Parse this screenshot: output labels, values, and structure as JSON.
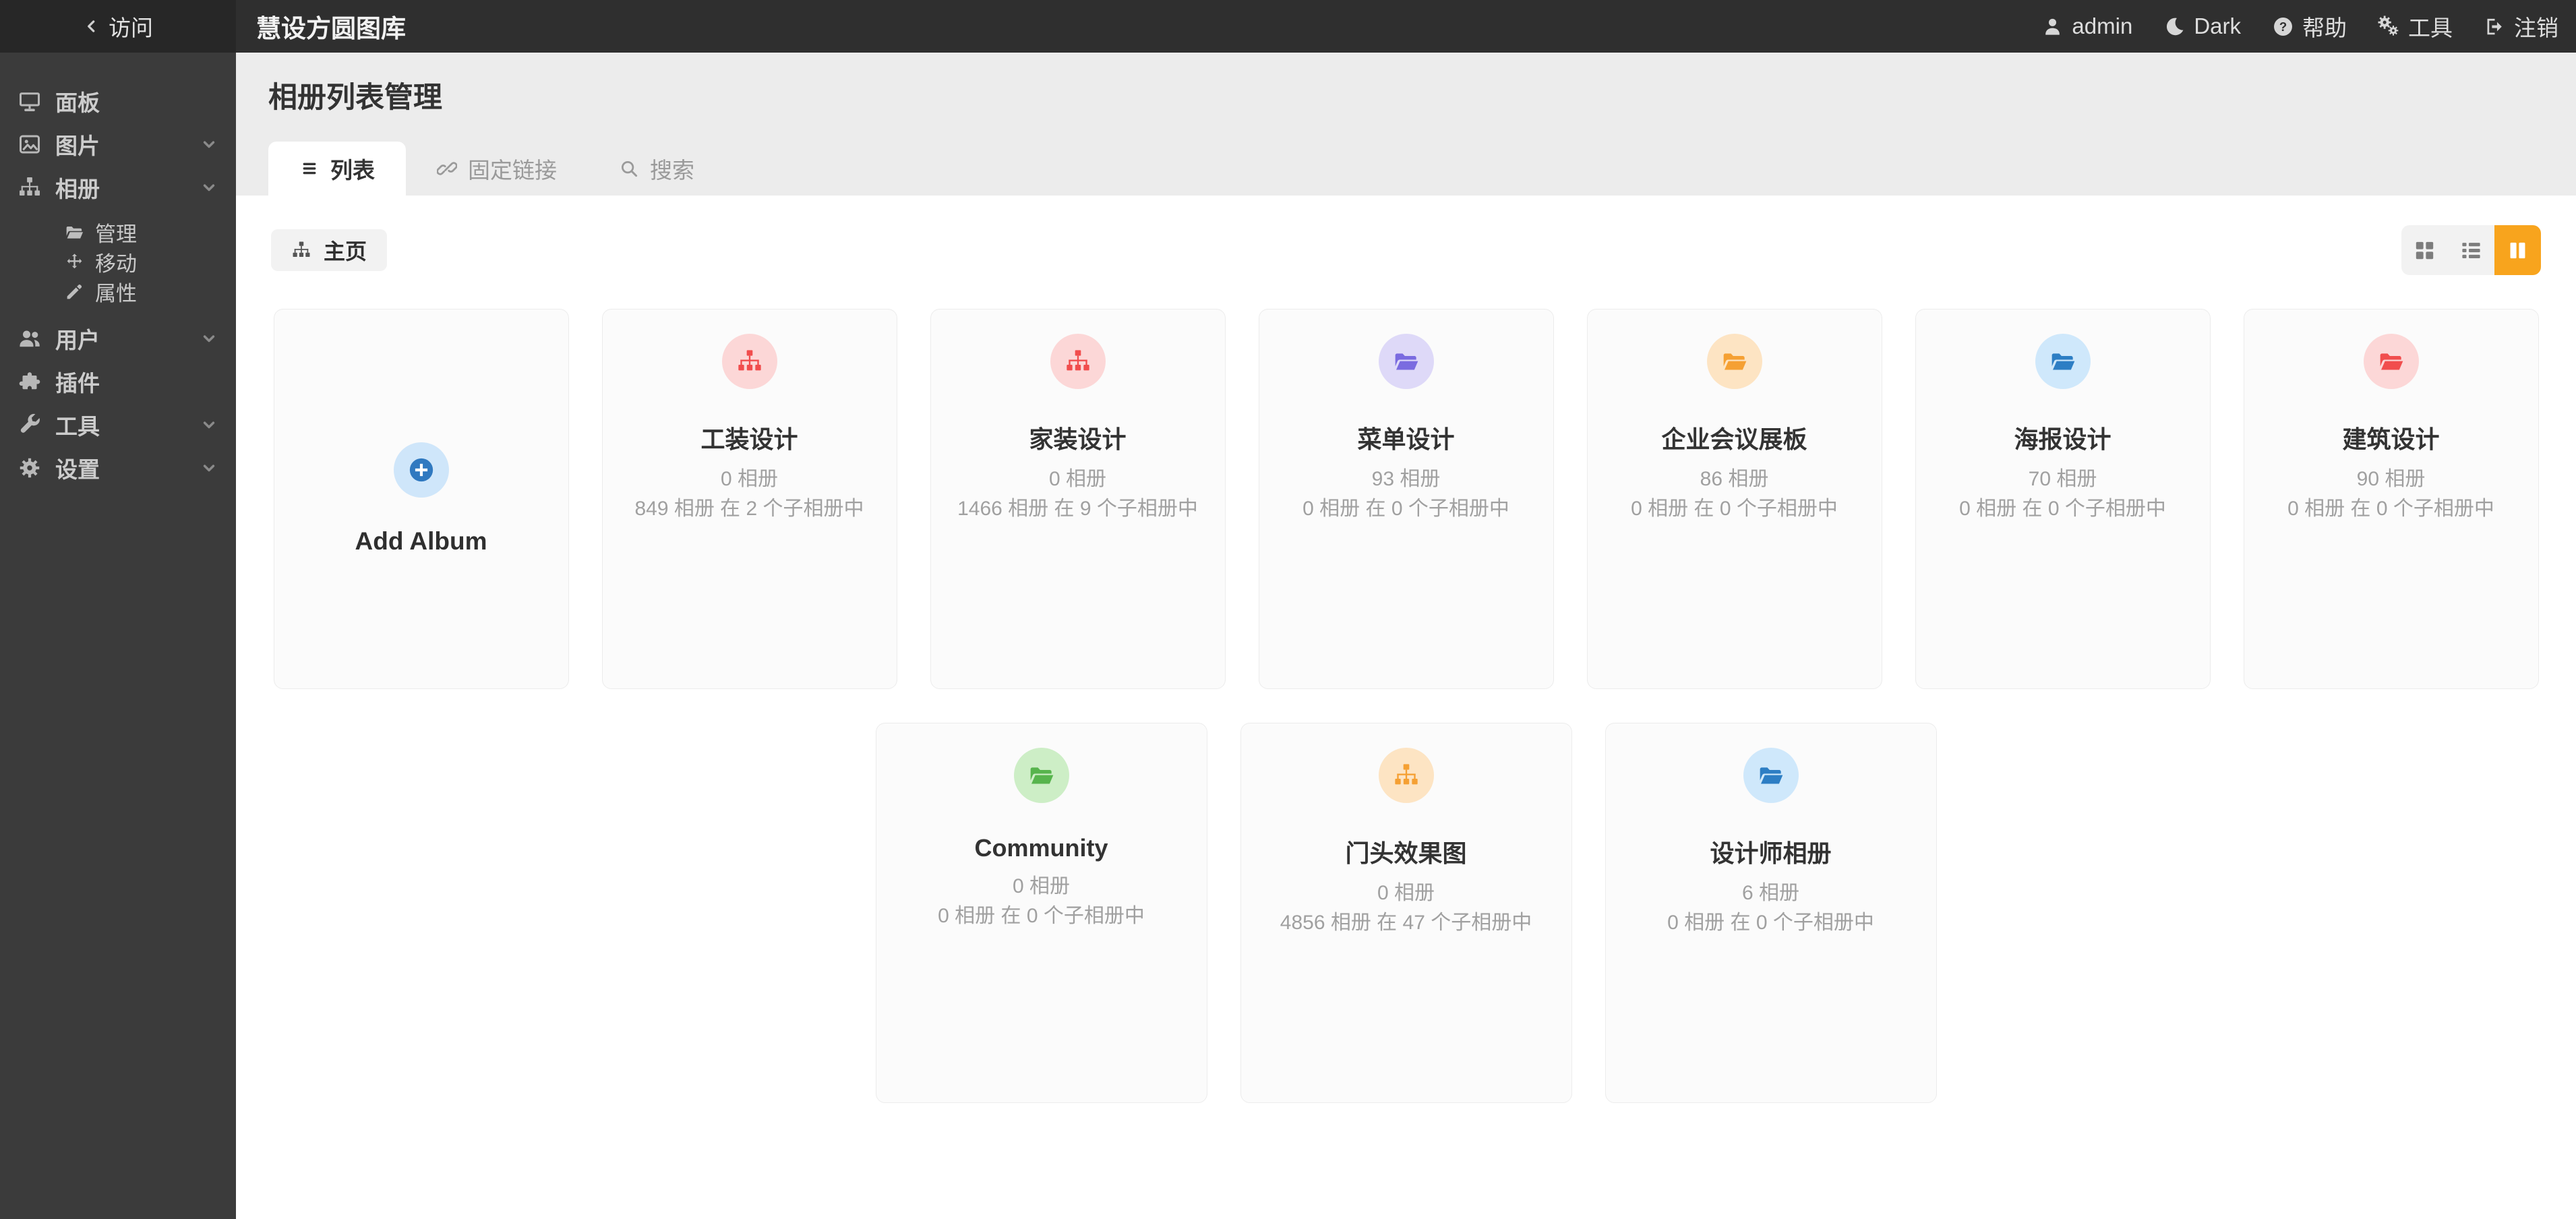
{
  "colors": {
    "accent_orange": "#f8a41d",
    "topbar_bg": "#2f2f2f",
    "sidebar_bg": "#3b3b3b",
    "header_bg": "#ececec"
  },
  "topbar": {
    "back_label": "访问",
    "app_title": "慧设方圆图库",
    "menu": [
      {
        "id": "user",
        "icon": "user-icon",
        "label": "admin"
      },
      {
        "id": "theme",
        "icon": "moon-icon",
        "label": "Dark"
      },
      {
        "id": "help",
        "icon": "help-icon",
        "label": "帮助"
      },
      {
        "id": "tools",
        "icon": "gears-icon",
        "label": "工具"
      },
      {
        "id": "logout",
        "icon": "sign-out-icon",
        "label": "注销"
      }
    ]
  },
  "sidebar": {
    "items": [
      {
        "id": "dashboard",
        "icon": "desktop-icon",
        "label": "面板",
        "chevron": false
      },
      {
        "id": "photos",
        "icon": "image-icon",
        "label": "图片",
        "chevron": true
      },
      {
        "id": "albums",
        "icon": "sitemap-icon",
        "label": "相册",
        "chevron": true,
        "children": [
          {
            "id": "manage",
            "icon": "folder-open-icon",
            "label": "管理"
          },
          {
            "id": "move",
            "icon": "move-icon",
            "label": "移动"
          },
          {
            "id": "properties",
            "icon": "pencil-icon",
            "label": "属性"
          }
        ]
      },
      {
        "id": "users",
        "icon": "users-icon",
        "label": "用户",
        "chevron": true
      },
      {
        "id": "plugins",
        "icon": "puzzle-icon",
        "label": "插件",
        "chevron": false
      },
      {
        "id": "tools",
        "icon": "wrench-icon",
        "label": "工具",
        "chevron": true
      },
      {
        "id": "settings",
        "icon": "gear-icon",
        "label": "设置",
        "chevron": true
      }
    ]
  },
  "page": {
    "title": "相册列表管理",
    "tabs": [
      {
        "id": "list",
        "icon": "list-icon",
        "label": "列表",
        "active": true
      },
      {
        "id": "permalinks",
        "icon": "link-icon",
        "label": "固定链接",
        "active": false
      },
      {
        "id": "search",
        "icon": "search-icon",
        "label": "搜索",
        "active": false
      }
    ],
    "breadcrumb": {
      "icon": "sitemap-icon",
      "label": "主页"
    },
    "view_toggle": [
      {
        "id": "grid",
        "icon": "grid-icon",
        "active": false
      },
      {
        "id": "list",
        "icon": "list-view-icon",
        "active": false
      },
      {
        "id": "columns",
        "icon": "columns-icon",
        "active": true
      }
    ]
  },
  "albums": {
    "add_card": {
      "label": "Add Album",
      "icon": "plus-circle-icon",
      "icon_color": "#3079c0",
      "circle_bg": "#cfe6fa"
    },
    "cards": [
      {
        "name": "工装设计",
        "icon": "sitemap-icon",
        "icon_color": "#f14d4d",
        "circle_bg": "#fcd7d7",
        "line1": "0 相册",
        "line2": "849 相册 在 2 个子相册中",
        "row": 1
      },
      {
        "name": "家装设计",
        "icon": "sitemap-icon",
        "icon_color": "#f14d4d",
        "circle_bg": "#fcd7d7",
        "line1": "0 相册",
        "line2": "1466 相册 在 9 个子相册中",
        "row": 1
      },
      {
        "name": "菜单设计",
        "icon": "folder-open-icon",
        "icon_color": "#7a6be0",
        "circle_bg": "#ded9f8",
        "line1": "93 相册",
        "line2": "0 相册 在 0 个子相册中",
        "row": 1
      },
      {
        "name": "企业会议展板",
        "icon": "folder-open-icon",
        "icon_color": "#f5a033",
        "circle_bg": "#fde4c3",
        "line1": "86 相册",
        "line2": "0 相册 在 0 个子相册中",
        "row": 1
      },
      {
        "name": "海报设计",
        "icon": "folder-open-icon",
        "icon_color": "#2d7ec4",
        "circle_bg": "#cfe8fb",
        "line1": "70 相册",
        "line2": "0 相册 在 0 个子相册中",
        "row": 1
      },
      {
        "name": "建筑设计",
        "icon": "folder-open-icon",
        "icon_color": "#f14d4d",
        "circle_bg": "#fcd7d7",
        "line1": "90 相册",
        "line2": "0 相册 在 0 个子相册中",
        "row": 1
      },
      {
        "name": "Community",
        "icon": "folder-open-icon",
        "icon_color": "#57b44d",
        "circle_bg": "#cdeec6",
        "line1": "0 相册",
        "line2": "0 相册 在 0 个子相册中",
        "row": 2
      },
      {
        "name": "门头效果图",
        "icon": "sitemap-icon",
        "icon_color": "#f5a033",
        "circle_bg": "#fde4c3",
        "line1": "0 相册",
        "line2": "4856 相册 在 47 个子相册中",
        "row": 2
      },
      {
        "name": "设计师相册",
        "icon": "folder-open-icon",
        "icon_color": "#2d7ec4",
        "circle_bg": "#cfe8fb",
        "line1": "6 相册",
        "line2": "0 相册 在 0 个子相册中",
        "row": 2
      }
    ]
  }
}
